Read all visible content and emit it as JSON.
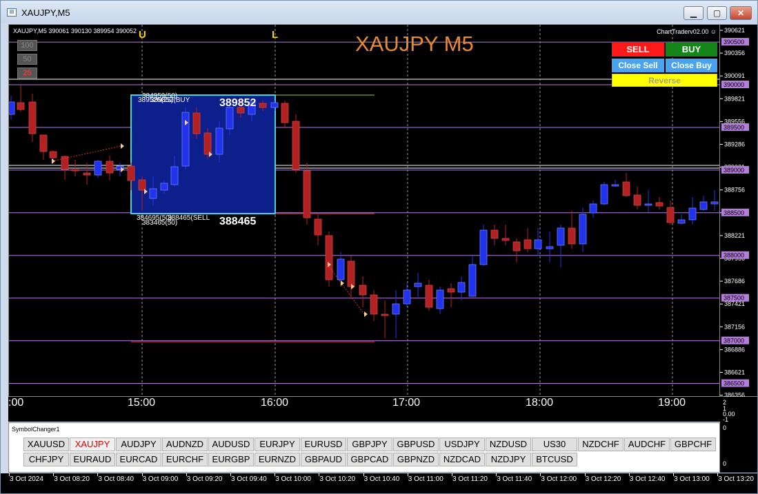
{
  "window": {
    "title": "XAUJPY,M5",
    "app_icon": "metatrader-app-icon",
    "controls": {
      "minimize": "minimize-icon",
      "maximize": "maximize-icon",
      "close": "close-icon"
    }
  },
  "chart": {
    "ohlc_header": "XAUJPY,M5  390061 390130 389954 390052",
    "big_title": "XAUJPY M5",
    "brand": "ChartTraderv02.00",
    "session_labels": [
      "U",
      "L"
    ],
    "lot_options": [
      "100",
      "50",
      "25"
    ],
    "trade_buttons": {
      "sell": "SELL",
      "buy": "BUY",
      "close_sell": "Close Sell",
      "close_buy": "Close Buy",
      "reverse": "Reverse"
    },
    "box": {
      "top_labels": [
        "384959(50)",
        "389526(25)",
        "389852(BUY"
      ],
      "top_value": "389852",
      "bottom_labels": [
        "384695(50)",
        "388465(SELL",
        "383465(50)"
      ],
      "bottom_value": "388465"
    },
    "colors": {
      "bull": "#2233ee",
      "bear": "#b22222",
      "grid": "#9a9a9a",
      "level": "#b57edc",
      "box": "#0d1f8a",
      "box_border": "#3fd3e8"
    }
  },
  "price_axis": {
    "ticks": [
      "390621",
      "390356",
      "390091",
      "389821",
      "389556",
      "389286",
      "389021",
      "388756",
      "388486",
      "388221",
      "387956",
      "387686",
      "387421",
      "387156",
      "386886",
      "386621",
      "386356"
    ],
    "level_badges": [
      "390500",
      "390000",
      "389500",
      "389000",
      "388500",
      "388000",
      "387500",
      "387000",
      "386500"
    ]
  },
  "time_axis": {
    "labels": [
      ":00",
      "15:00",
      "16:00",
      "17:00",
      "18:00",
      "19:00"
    ]
  },
  "indicator": {
    "title": "SymbolChanger1",
    "axis_labels": [
      "2",
      "1",
      "0.00",
      "-1",
      "0"
    ],
    "row1": [
      "XAUUSD",
      "XAUJPY",
      "AUDJPY",
      "AUDNZD",
      "AUDUSD",
      "EURJPY",
      "EURUSD",
      "GBPJPY",
      "GBPUSD",
      "USDJPY",
      "NZDUSD",
      "US30",
      "NZDCHF",
      "AUDCHF",
      "GBPCHF"
    ],
    "row2": [
      "CHFJPY",
      "EURAUD",
      "EURCAD",
      "EURCHF",
      "EURGBP",
      "EURNZD",
      "GBPAUD",
      "GBPCAD",
      "GBPNZD",
      "NZDCAD",
      "NZDJPY",
      "BTCUSD"
    ],
    "active": "XAUJPY"
  },
  "date_axis": {
    "labels": [
      "3 Oct 2024",
      "3 Oct 08:20",
      "3 Oct 08:40",
      "3 Oct 09:00",
      "3 Oct 09:20",
      "3 Oct 09:40",
      "3 Oct 10:00",
      "3 Oct 10:20",
      "3 Oct 10:40",
      "3 Oct 11:00",
      "3 Oct 11:20",
      "3 Oct 11:40",
      "3 Oct 12:00",
      "3 Oct 12:20",
      "3 Oct 12:40",
      "3 Oct 13:00",
      "3 Oct 13:20"
    ]
  }
}
